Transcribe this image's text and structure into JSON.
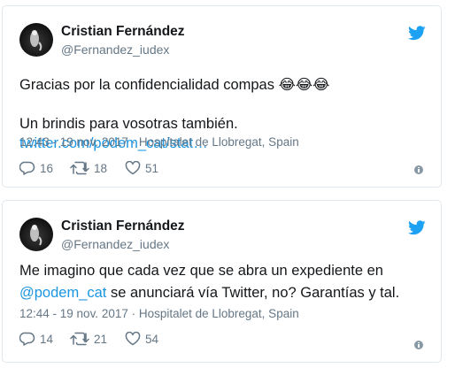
{
  "tweets": [
    {
      "author_name": "Cristian Fernández",
      "handle": "@Fernandez_iudex",
      "text_line1": "Gracias por la confidencialidad compas",
      "emoji": "😂😂😂",
      "text_line2": "Un brindis para vosotras también. ",
      "link": "twitter.com/podem_cat/stat…",
      "timestamp": "12:43 - 19 nov. 2017 · Hospitalet de Llobregat, Spain",
      "replies": "16",
      "retweets": "18",
      "likes": "51"
    },
    {
      "author_name": "Cristian Fernández",
      "handle": "@Fernandez_iudex",
      "text_line1": "Me imagino que cada vez que se abra un expediente en",
      "mention": "@podem_cat",
      "text_line2_rest": " se anunciará vía Twitter, no? Garantías y tal.",
      "timestamp": "12:44 - 19 nov. 2017 · Hospitalet de Llobregat, Spain",
      "replies": "14",
      "retweets": "21",
      "likes": "54"
    }
  ],
  "icons": [
    "avatar",
    "twitter-bird-icon",
    "reply-icon",
    "retweet-icon",
    "like-icon",
    "info-icon"
  ],
  "colors": {
    "link": "#1b95e0",
    "muted": "#657786",
    "border": "#e1e8ed",
    "text": "#14171a"
  }
}
